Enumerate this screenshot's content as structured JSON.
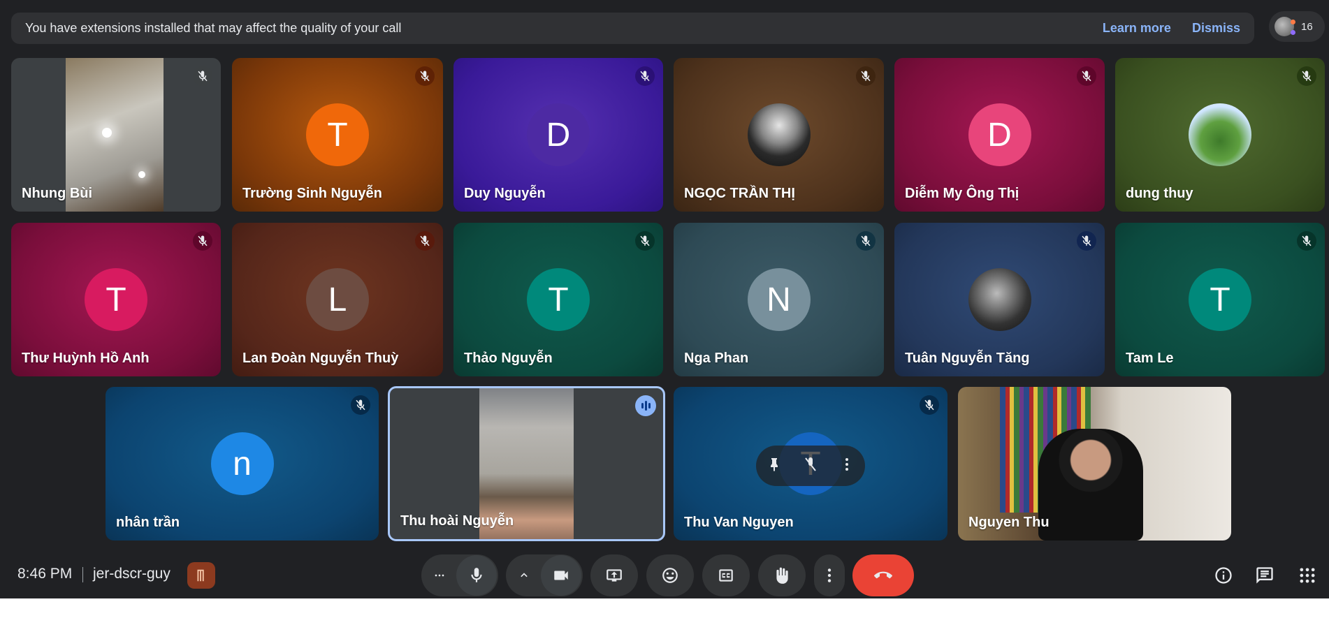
{
  "banner": {
    "message": "You have extensions installed that may affect the quality of your call",
    "learn_more": "Learn more",
    "dismiss": "Dismiss"
  },
  "people": {
    "count": "16",
    "icon": "people-icon"
  },
  "tiles": [
    {
      "name": "Nhung Bùi",
      "type": "camera"
    },
    {
      "name": "Trường Sinh Nguyễn",
      "initial": "T",
      "avatar_color": "#f0680a",
      "bg": "#8a3b09"
    },
    {
      "name": "Duy Nguyễn",
      "initial": "D",
      "avatar_color": "#4d2aa3",
      "bg": "#3a1a99"
    },
    {
      "name": "NGỌC TRẦN THỊ",
      "type": "photo",
      "bg": "#5b3a22"
    },
    {
      "name": "Diễm My Ông Thị",
      "initial": "D",
      "avatar_color": "#e8457b",
      "bg": "#8b1244"
    },
    {
      "name": "dung thuy",
      "type": "photo",
      "bg": "#3d5224"
    },
    {
      "name": "Thư Huỳnh Hồ Anh",
      "initial": "T",
      "avatar_color": "#d81b60",
      "bg": "#8b1245"
    },
    {
      "name": "Lan Đoàn Nguyễn Thuỳ",
      "initial": "L",
      "avatar_color": "#6d4c41",
      "bg": "#5a2a1a"
    },
    {
      "name": "Thảo Nguyễn",
      "initial": "T",
      "avatar_color": "#00897b",
      "bg": "#0c4a3f"
    },
    {
      "name": "Nga Phan",
      "initial": "N",
      "avatar_color": "#78909c",
      "bg": "#2e4a55"
    },
    {
      "name": "Tuân Nguyễn Tăng",
      "type": "photo",
      "bg": "#23375a"
    },
    {
      "name": "Tam Le",
      "initial": "T",
      "avatar_color": "#00897b",
      "bg": "#0c4a3f"
    },
    {
      "name": "nhân trần",
      "initial": "n",
      "avatar_color": "#1e88e5",
      "bg": "#0c4470"
    },
    {
      "name": "Thu hoài Nguyễn",
      "type": "camera",
      "speaking": true
    },
    {
      "name": "Thu Van Nguyen",
      "initial": "T",
      "avatar_color": "#1565c0",
      "bg": "#0c4470"
    },
    {
      "name": "Nguyen Thu",
      "type": "camera"
    }
  ],
  "bottom": {
    "time": "8:46 PM",
    "meeting_code": "jer-dscr-guy"
  }
}
